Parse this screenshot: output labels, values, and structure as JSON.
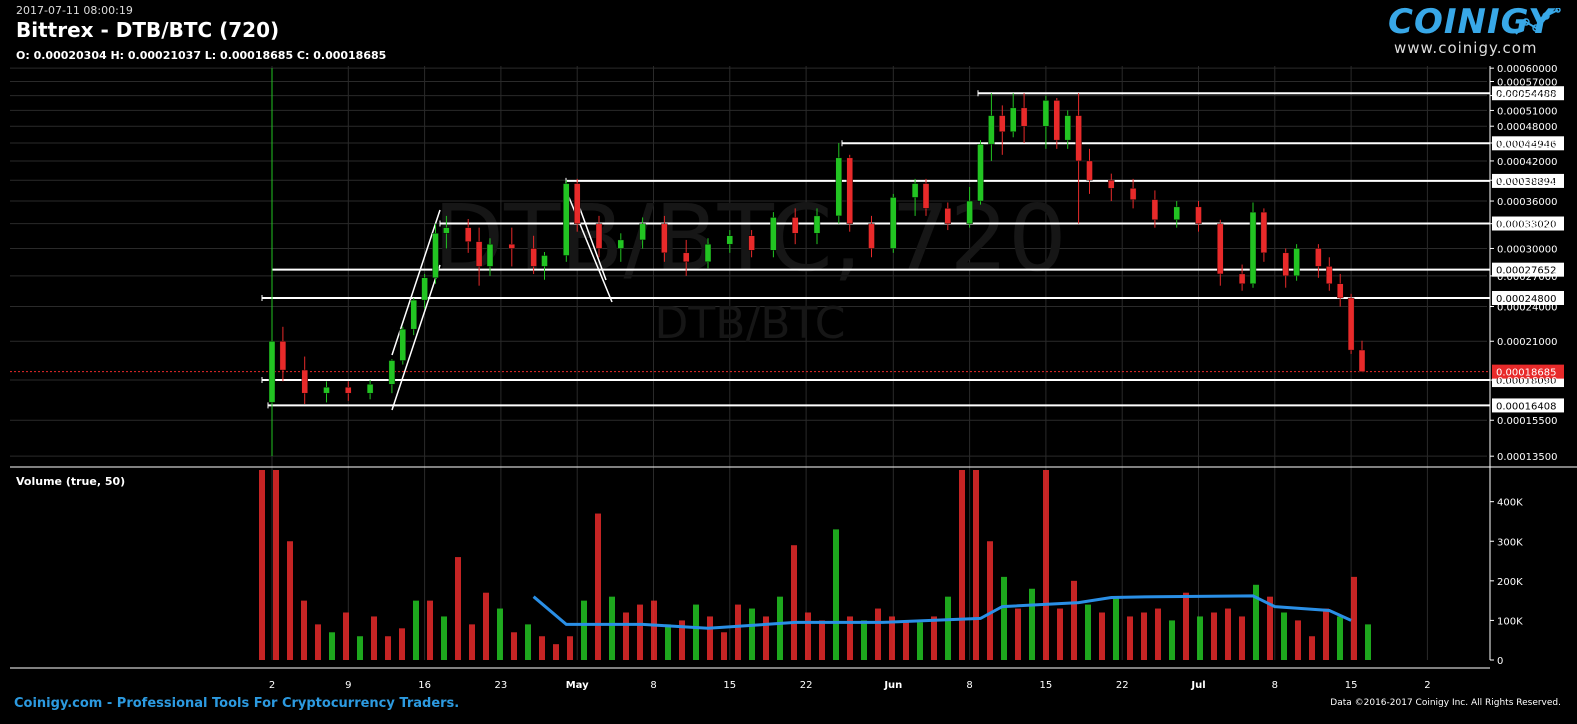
{
  "header": {
    "timestamp": "2017-07-11 08:00:19",
    "title": "Bittrex - DTB/BTC (720)",
    "ohlc": "O: 0.00020304 H: 0.00021037 L: 0.00018685 C: 0.00018685"
  },
  "logo": {
    "text": "COINIGY",
    "url": "www.coinigy.com"
  },
  "watermark": {
    "big": "DTB/BTC, 720",
    "small": "DTB/BTC"
  },
  "footer": {
    "left": "Coinigy.com - Professional Tools For Cryptocurrency Traders.",
    "right": "Data ©2016-2017 Coinigy Inc. All Rights Reserved."
  },
  "colors": {
    "up": "#22c422",
    "down": "#e82a2a",
    "ma": "#2a8fe6",
    "grid": "#2a2a2a",
    "line": "#ffffff",
    "brand": "#2c9ae0"
  },
  "chart_data": [
    {
      "type": "candlestick",
      "title": "Bittrex - DTB/BTC (720)",
      "interval": "720",
      "x_tick_labels": [
        "2",
        "9",
        "16",
        "23",
        "May",
        "8",
        "15",
        "22",
        "Jun",
        "8",
        "15",
        "22",
        "Jul",
        "8",
        "15",
        "2"
      ],
      "y_ticks": [
        0.000135,
        0.000155,
        0.0001809,
        0.00021,
        0.00024,
        0.00027,
        0.0003,
        0.00033,
        0.00036,
        0.00039,
        0.00042,
        0.00045,
        0.00048,
        0.00051,
        0.00054,
        0.00057,
        0.0006
      ],
      "y_scale": "log",
      "ylim": [
        0.00013,
        0.000605
      ],
      "last_price": "0.00018685",
      "horizontal_levels": [
        "0.00054488",
        "0.00044946",
        "0.00038894",
        "0.00033020",
        "0.00027652",
        "0.00024800",
        "0.00018090",
        "0.00016408"
      ],
      "ohlc_points": [
        {
          "date": "2017-04-02",
          "o": 0.000166,
          "h": 0.0006,
          "l": 0.000135,
          "c": 0.00021
        },
        {
          "date": "2017-04-03",
          "o": 0.00021,
          "h": 0.000222,
          "l": 0.00018,
          "c": 0.000188
        },
        {
          "date": "2017-04-05",
          "o": 0.000188,
          "h": 0.000198,
          "l": 0.000165,
          "c": 0.000172
        },
        {
          "date": "2017-04-07",
          "o": 0.000172,
          "h": 0.00018,
          "l": 0.000166,
          "c": 0.000176
        },
        {
          "date": "2017-04-09",
          "o": 0.000176,
          "h": 0.00018,
          "l": 0.000167,
          "c": 0.000172
        },
        {
          "date": "2017-04-11",
          "o": 0.000172,
          "h": 0.000181,
          "l": 0.000168,
          "c": 0.000178
        },
        {
          "date": "2017-04-13",
          "o": 0.000178,
          "h": 0.000196,
          "l": 0.000172,
          "c": 0.000195
        },
        {
          "date": "2017-04-14",
          "o": 0.000195,
          "h": 0.000222,
          "l": 0.000192,
          "c": 0.00022
        },
        {
          "date": "2017-04-15",
          "o": 0.00022,
          "h": 0.000248,
          "l": 0.000215,
          "c": 0.000246
        },
        {
          "date": "2017-04-16",
          "o": 0.000246,
          "h": 0.000272,
          "l": 0.000238,
          "c": 0.000268
        },
        {
          "date": "2017-04-17",
          "o": 0.000268,
          "h": 0.00033,
          "l": 0.000262,
          "c": 0.000318
        },
        {
          "date": "2017-04-18",
          "o": 0.000318,
          "h": 0.00034,
          "l": 0.0003,
          "c": 0.000325
        },
        {
          "date": "2017-04-20",
          "o": 0.000325,
          "h": 0.000336,
          "l": 0.000295,
          "c": 0.000308
        },
        {
          "date": "2017-04-21",
          "o": 0.000308,
          "h": 0.000325,
          "l": 0.00026,
          "c": 0.00028
        },
        {
          "date": "2017-04-22",
          "o": 0.00028,
          "h": 0.000312,
          "l": 0.00027,
          "c": 0.000305
        },
        {
          "date": "2017-04-24",
          "o": 0.000305,
          "h": 0.000325,
          "l": 0.00028,
          "c": 0.0003
        },
        {
          "date": "2017-04-26",
          "o": 0.0003,
          "h": 0.000315,
          "l": 0.000272,
          "c": 0.00028
        },
        {
          "date": "2017-04-27",
          "o": 0.00028,
          "h": 0.000296,
          "l": 0.000266,
          "c": 0.000292
        },
        {
          "date": "2017-04-29",
          "o": 0.000292,
          "h": 0.00039,
          "l": 0.000285,
          "c": 0.000385
        },
        {
          "date": "2017-04-30",
          "o": 0.000385,
          "h": 0.000392,
          "l": 0.00032,
          "c": 0.00033
        },
        {
          "date": "2017-05-02",
          "o": 0.00033,
          "h": 0.00034,
          "l": 0.00029,
          "c": 0.0003
        },
        {
          "date": "2017-05-04",
          "o": 0.0003,
          "h": 0.000318,
          "l": 0.000285,
          "c": 0.00031
        },
        {
          "date": "2017-05-06",
          "o": 0.00031,
          "h": 0.000338,
          "l": 0.0003,
          "c": 0.00033
        },
        {
          "date": "2017-05-08",
          "o": 0.00033,
          "h": 0.00034,
          "l": 0.000285,
          "c": 0.000295
        },
        {
          "date": "2017-05-10",
          "o": 0.000295,
          "h": 0.00031,
          "l": 0.00027,
          "c": 0.000285
        },
        {
          "date": "2017-05-12",
          "o": 0.000285,
          "h": 0.000312,
          "l": 0.000278,
          "c": 0.000305
        },
        {
          "date": "2017-05-14",
          "o": 0.000305,
          "h": 0.000322,
          "l": 0.000295,
          "c": 0.000315
        },
        {
          "date": "2017-05-16",
          "o": 0.000315,
          "h": 0.000322,
          "l": 0.00029,
          "c": 0.000298
        },
        {
          "date": "2017-05-18",
          "o": 0.000298,
          "h": 0.000345,
          "l": 0.00029,
          "c": 0.000338
        },
        {
          "date": "2017-05-20",
          "o": 0.000338,
          "h": 0.00035,
          "l": 0.000305,
          "c": 0.000318
        },
        {
          "date": "2017-05-22",
          "o": 0.000318,
          "h": 0.00035,
          "l": 0.000305,
          "c": 0.00034
        },
        {
          "date": "2017-05-24",
          "o": 0.00034,
          "h": 0.00045,
          "l": 0.00033,
          "c": 0.000425
        },
        {
          "date": "2017-05-25",
          "o": 0.000425,
          "h": 0.00043,
          "l": 0.00032,
          "c": 0.00033
        },
        {
          "date": "2017-05-27",
          "o": 0.00033,
          "h": 0.00034,
          "l": 0.00029,
          "c": 0.0003
        },
        {
          "date": "2017-05-29",
          "o": 0.0003,
          "h": 0.00037,
          "l": 0.000295,
          "c": 0.000365
        },
        {
          "date": "2017-05-31",
          "o": 0.000365,
          "h": 0.000392,
          "l": 0.00034,
          "c": 0.000385
        },
        {
          "date": "2017-06-01",
          "o": 0.000385,
          "h": 0.000392,
          "l": 0.00034,
          "c": 0.00035
        },
        {
          "date": "2017-06-03",
          "o": 0.00035,
          "h": 0.000358,
          "l": 0.000322,
          "c": 0.00033
        },
        {
          "date": "2017-06-05",
          "o": 0.00033,
          "h": 0.00038,
          "l": 0.000325,
          "c": 0.00036
        },
        {
          "date": "2017-06-06",
          "o": 0.00036,
          "h": 0.000455,
          "l": 0.000355,
          "c": 0.000448
        },
        {
          "date": "2017-06-07",
          "o": 0.000448,
          "h": 0.000545,
          "l": 0.00042,
          "c": 0.0005
        },
        {
          "date": "2017-06-08",
          "o": 0.0005,
          "h": 0.00052,
          "l": 0.00043,
          "c": 0.00047
        },
        {
          "date": "2017-06-09",
          "o": 0.00047,
          "h": 0.000545,
          "l": 0.00046,
          "c": 0.000515
        },
        {
          "date": "2017-06-10",
          "o": 0.000515,
          "h": 0.000545,
          "l": 0.00045,
          "c": 0.00048
        },
        {
          "date": "2017-06-12",
          "o": 0.00048,
          "h": 0.00054,
          "l": 0.00044,
          "c": 0.00053
        },
        {
          "date": "2017-06-13",
          "o": 0.00053,
          "h": 0.000535,
          "l": 0.00044,
          "c": 0.000455
        },
        {
          "date": "2017-06-14",
          "o": 0.000455,
          "h": 0.00051,
          "l": 0.00044,
          "c": 0.0005
        },
        {
          "date": "2017-06-15",
          "o": 0.0005,
          "h": 0.000545,
          "l": 0.00033,
          "c": 0.00042
        },
        {
          "date": "2017-06-16",
          "o": 0.00042,
          "h": 0.00044,
          "l": 0.00037,
          "c": 0.00039
        },
        {
          "date": "2017-06-18",
          "o": 0.00039,
          "h": 0.0004,
          "l": 0.00036,
          "c": 0.000378
        },
        {
          "date": "2017-06-20",
          "o": 0.000378,
          "h": 0.000392,
          "l": 0.00035,
          "c": 0.000362
        },
        {
          "date": "2017-06-22",
          "o": 0.000362,
          "h": 0.000375,
          "l": 0.000325,
          "c": 0.000335
        },
        {
          "date": "2017-06-24",
          "o": 0.000335,
          "h": 0.00036,
          "l": 0.000325,
          "c": 0.000352
        },
        {
          "date": "2017-06-26",
          "o": 0.000352,
          "h": 0.00036,
          "l": 0.00032,
          "c": 0.00033
        },
        {
          "date": "2017-06-28",
          "o": 0.00033,
          "h": 0.000335,
          "l": 0.00026,
          "c": 0.000272
        },
        {
          "date": "2017-06-30",
          "o": 0.000272,
          "h": 0.000282,
          "l": 0.000255,
          "c": 0.000262
        },
        {
          "date": "2017-07-01",
          "o": 0.000262,
          "h": 0.000358,
          "l": 0.000258,
          "c": 0.000345
        },
        {
          "date": "2017-07-02",
          "o": 0.000345,
          "h": 0.00035,
          "l": 0.000285,
          "c": 0.000295
        },
        {
          "date": "2017-07-04",
          "o": 0.000295,
          "h": 0.0003,
          "l": 0.000258,
          "c": 0.00027
        },
        {
          "date": "2017-07-05",
          "o": 0.00027,
          "h": 0.000305,
          "l": 0.000265,
          "c": 0.0003
        },
        {
          "date": "2017-07-07",
          "o": 0.0003,
          "h": 0.000305,
          "l": 0.000268,
          "c": 0.00028
        },
        {
          "date": "2017-07-08",
          "o": 0.00028,
          "h": 0.00029,
          "l": 0.000255,
          "c": 0.000262
        },
        {
          "date": "2017-07-09",
          "o": 0.000262,
          "h": 0.000272,
          "l": 0.00024,
          "c": 0.000248
        },
        {
          "date": "2017-07-10",
          "o": 0.000248,
          "h": 0.000252,
          "l": 0.0002,
          "c": 0.000203
        },
        {
          "date": "2017-07-11",
          "o": 0.00020304,
          "h": 0.00021037,
          "l": 0.00018685,
          "c": 0.00018685
        }
      ]
    },
    {
      "type": "bar",
      "title": "Volume (true, 50)",
      "y_tick_labels": [
        "400K",
        "300K",
        "200K",
        "100K",
        "0"
      ],
      "ylim": [
        0,
        480000
      ],
      "values": [
        480000,
        480000,
        300000,
        150000,
        90000,
        70000,
        120000,
        60000,
        110000,
        60000,
        80000,
        150000,
        150000,
        110000,
        260000,
        90000,
        170000,
        130000,
        70000,
        90000,
        60000,
        40000,
        60000,
        150000,
        370000,
        160000,
        120000,
        140000,
        150000,
        90000,
        100000,
        140000,
        110000,
        70000,
        140000,
        130000,
        110000,
        160000,
        290000,
        120000,
        100000,
        330000,
        110000,
        100000,
        130000,
        110000,
        100000,
        95000,
        110000,
        160000,
        480000,
        480000,
        300000,
        210000,
        130000,
        180000,
        480000,
        130000,
        200000,
        140000,
        120000,
        160000,
        110000,
        120000,
        130000,
        100000,
        170000,
        110000,
        120000,
        130000,
        110000,
        190000,
        160000,
        120000,
        100000,
        60000,
        130000,
        110000,
        210000,
        90000
      ],
      "ma_points": [
        {
          "date": "2017-04-26",
          "v": 160000
        },
        {
          "date": "2017-04-29",
          "v": 90000
        },
        {
          "date": "2017-05-06",
          "v": 90000
        },
        {
          "date": "2017-05-12",
          "v": 80000
        },
        {
          "date": "2017-05-20",
          "v": 95000
        },
        {
          "date": "2017-05-28",
          "v": 95000
        },
        {
          "date": "2017-06-06",
          "v": 105000
        },
        {
          "date": "2017-06-08",
          "v": 135000
        },
        {
          "date": "2017-06-15",
          "v": 145000
        },
        {
          "date": "2017-06-18",
          "v": 158000
        },
        {
          "date": "2017-06-22",
          "v": 160000
        },
        {
          "date": "2017-07-01",
          "v": 162000
        },
        {
          "date": "2017-07-03",
          "v": 135000
        },
        {
          "date": "2017-07-08",
          "v": 125000
        },
        {
          "date": "2017-07-10",
          "v": 100000
        }
      ]
    }
  ]
}
